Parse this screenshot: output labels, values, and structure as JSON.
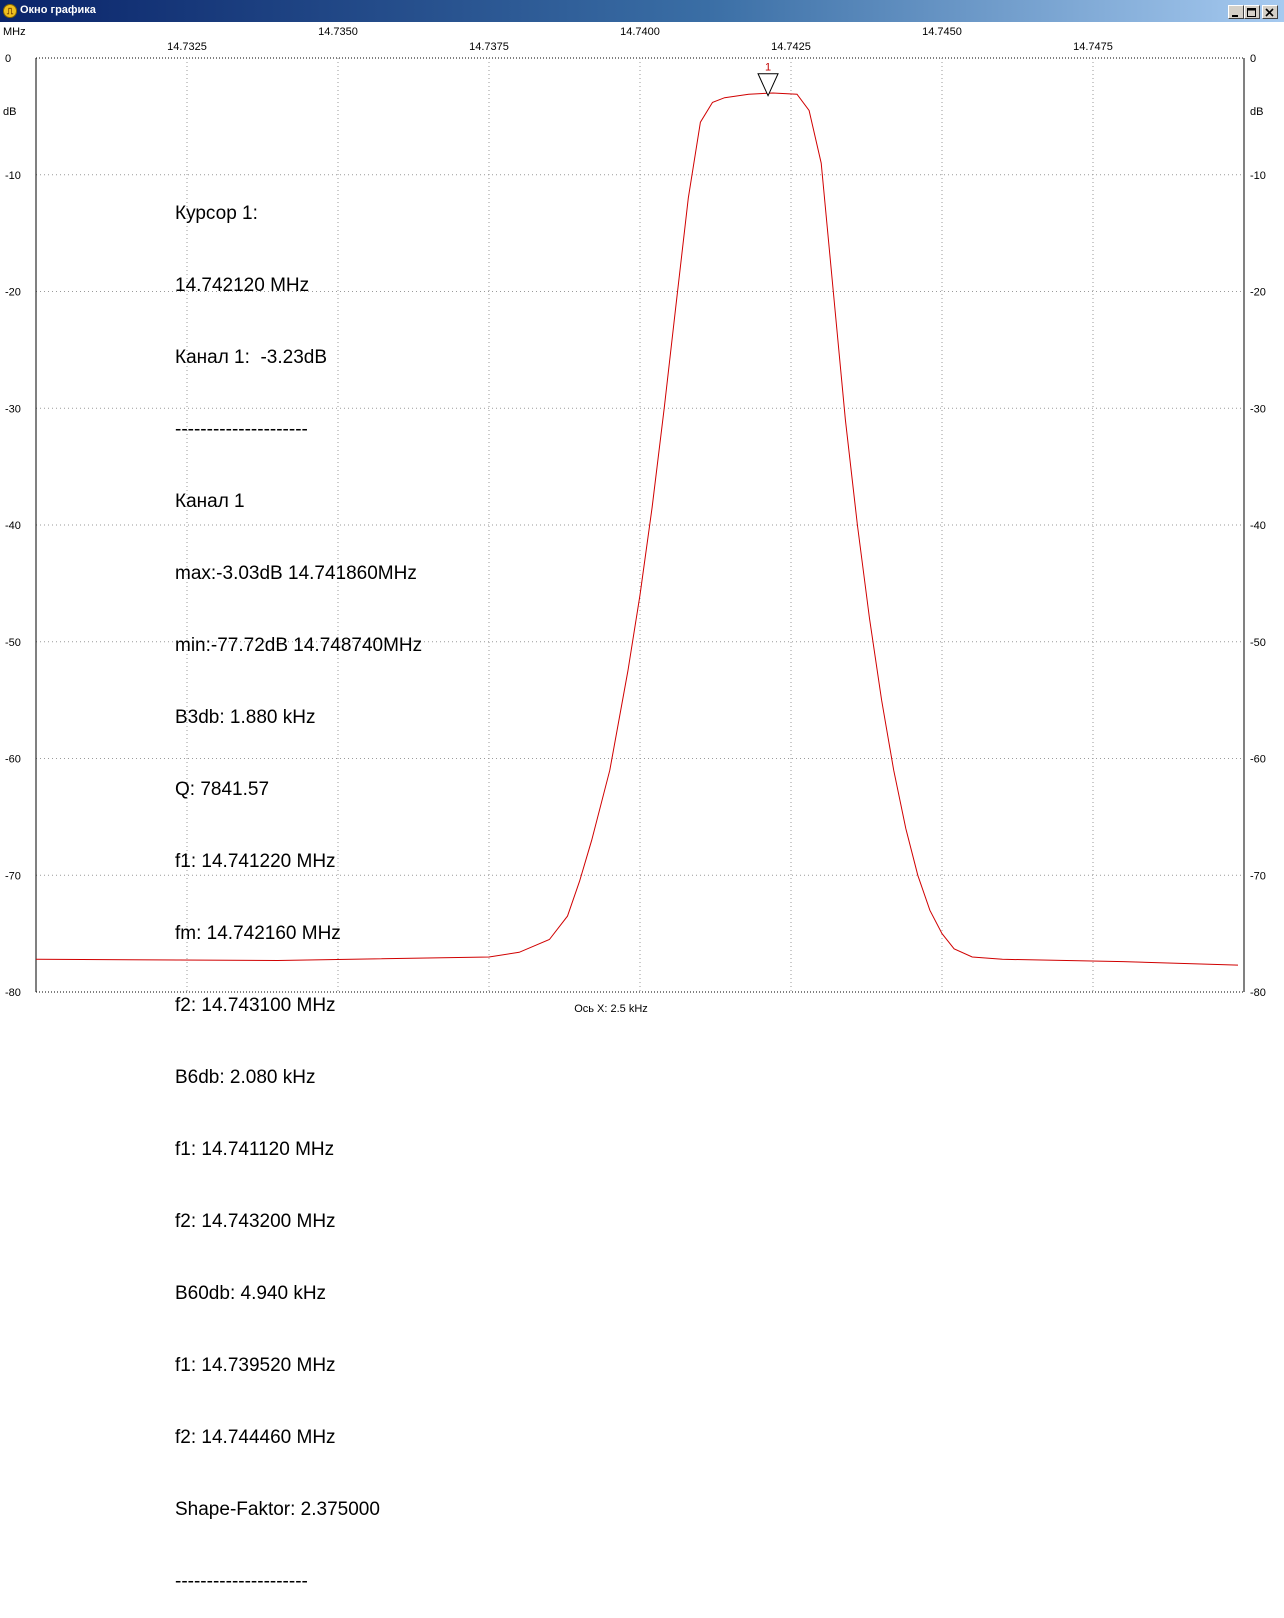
{
  "window": {
    "title": "Окно графика",
    "icon": "yellow-circle-app-icon",
    "controls": [
      "minimize",
      "maximize",
      "close"
    ]
  },
  "axis_units": {
    "x": "MHz",
    "y": "dB"
  },
  "x_axis_caption": "Ось X: 2.5 kHz",
  "marker_label": "1",
  "info_lines": [
    "Курсор 1:",
    "14.742120 MHz",
    "Канал 1:  -3.23dB",
    "---------------------",
    "Канал 1",
    "max:-3.03dB 14.741860MHz",
    "min:-77.72dB 14.748740MHz",
    "B3db: 1.880 kHz",
    "Q: 7841.57",
    "f1: 14.741220 MHz",
    "fm: 14.742160 MHz",
    "f2: 14.743100 MHz",
    "B6db: 2.080 kHz",
    "f1: 14.741120 MHz",
    "f2: 14.743200 MHz",
    "B60db: 4.940 kHz",
    "f1: 14.739520 MHz",
    "f2: 14.744460 MHz",
    "Shape-Faktor: 2.375000",
    "---------------------"
  ],
  "chart_data": {
    "type": "line",
    "xlabel": "MHz",
    "ylabel": "dB",
    "xlim": [
      14.73,
      14.75
    ],
    "ylim": [
      -80,
      0
    ],
    "x_ticks_upper": [
      "14.7350",
      "14.7400",
      "14.7450"
    ],
    "x_ticks_lower": [
      "14.7325",
      "14.7375",
      "14.7425",
      "14.7475"
    ],
    "x_tick_values_upper": [
      14.735,
      14.74,
      14.745
    ],
    "x_tick_values_lower": [
      14.7325,
      14.7375,
      14.7425,
      14.7475
    ],
    "y_ticks": [
      "0",
      "-10",
      "-20",
      "-30",
      "-40",
      "-50",
      "-60",
      "-70",
      "-80"
    ],
    "y_tick_values": [
      0,
      -10,
      -20,
      -30,
      -40,
      -50,
      -60,
      -70,
      -80
    ],
    "grid": true,
    "line_color": "#d00000",
    "cursor": {
      "x": 14.74212,
      "y": -3.23
    },
    "series": [
      {
        "x": [
          14.73,
          14.734,
          14.7375,
          14.738,
          14.7385,
          14.7388,
          14.739,
          14.7392,
          14.7395,
          14.7398,
          14.74,
          14.7402,
          14.7404,
          14.7406,
          14.7408,
          14.741,
          14.7412,
          14.7414,
          14.7418,
          14.7422,
          14.7426,
          14.7428,
          14.743,
          14.7432,
          14.7434,
          14.7436,
          14.7438,
          14.744,
          14.7442,
          14.7444,
          14.7446,
          14.7448,
          14.745,
          14.7452,
          14.7455,
          14.746,
          14.748,
          14.7499
        ],
        "values": [
          -77.2,
          -77.3,
          -77.0,
          -76.6,
          -75.5,
          -73.5,
          -70.5,
          -67.0,
          -61.0,
          -52.5,
          -46.0,
          -38.5,
          -30.0,
          -21.0,
          -12.0,
          -5.5,
          -3.8,
          -3.4,
          -3.1,
          -3.0,
          -3.1,
          -4.5,
          -9.0,
          -20.0,
          -31.0,
          -40.0,
          -48.0,
          -55.0,
          -61.0,
          -66.0,
          -70.0,
          -73.0,
          -75.0,
          -76.3,
          -77.0,
          -77.2,
          -77.4,
          -77.7
        ]
      }
    ]
  }
}
